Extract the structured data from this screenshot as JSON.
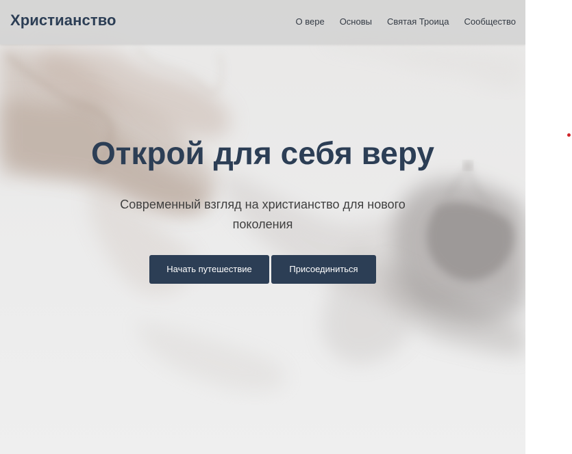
{
  "header": {
    "brand": "Христианство",
    "nav": [
      "О вере",
      "Основы",
      "Святая Троица",
      "Сообщество"
    ]
  },
  "hero": {
    "title": "Открой для себя веру",
    "subtitle": "Современный взгляд на христианство для нового поколения",
    "buttons": {
      "primary": "Начать путешествие",
      "secondary": "Присоединиться"
    }
  },
  "colors": {
    "accent": "#2c3e55",
    "nav_background": "#d4d4d4",
    "hero_background": "#ededed",
    "marker": "#d0262b"
  }
}
